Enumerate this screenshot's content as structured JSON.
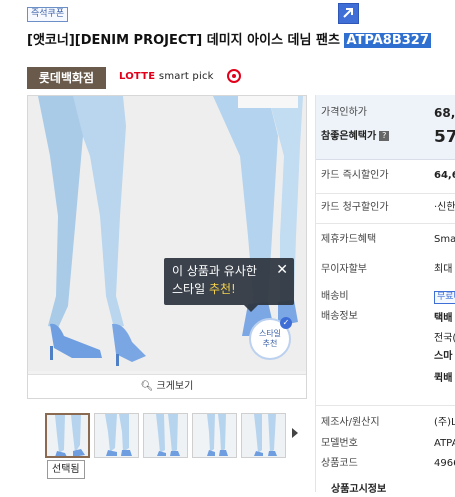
{
  "badge": "즉석쿠폰",
  "title": {
    "text": "[앳코너][DENIM PROJECT] 데미지 아이스 데님 팬츠 ",
    "code": "ATPA8B327"
  },
  "store": {
    "name": "롯데백화점",
    "partner_brand": "LOTTE",
    "partner_sub": "smart pick"
  },
  "image": {
    "zoom_label": "크게보기",
    "tooltip_line1": "이 상품과 유사한",
    "tooltip_line2a": "스타일 ",
    "tooltip_line2b": "추천!",
    "style_badge_1": "스타일",
    "style_badge_2": "추천",
    "selected_tooltip": "선택됨",
    "thumbnail_count": 5
  },
  "info": {
    "price_label": "가격인하가",
    "price_value": "68,0",
    "benefit_label": "참좋은혜택가",
    "benefit_value": "57",
    "card_discount_label": "카드 즉시할인가",
    "card_discount_value": "64,6",
    "card_bill_label": "카드 청구할인가",
    "card_bill_value": "·신한",
    "partner_card_label": "제휴카드혜택",
    "partner_card_value": "Smart",
    "installment_label": "무이자할부",
    "installment_value": "최대",
    "shipping_label": "배송비",
    "shipping_value": "무료배",
    "delivery_label": "배송정보",
    "delivery_values": [
      "택배",
      "전국(",
      "스마",
      "퀵배"
    ],
    "maker_label": "제조사/원산지",
    "maker_value": "(주)L",
    "model_label": "모델번호",
    "model_value": "ATPA",
    "code_label": "상품코드",
    "code_value": "4966",
    "bottom_label": "상품고시정보"
  },
  "colors": {
    "accent": "#2f6fd0",
    "store_bg": "#6a5a4b",
    "orange": "#ee5b08",
    "lotte_red": "#e2001a"
  }
}
